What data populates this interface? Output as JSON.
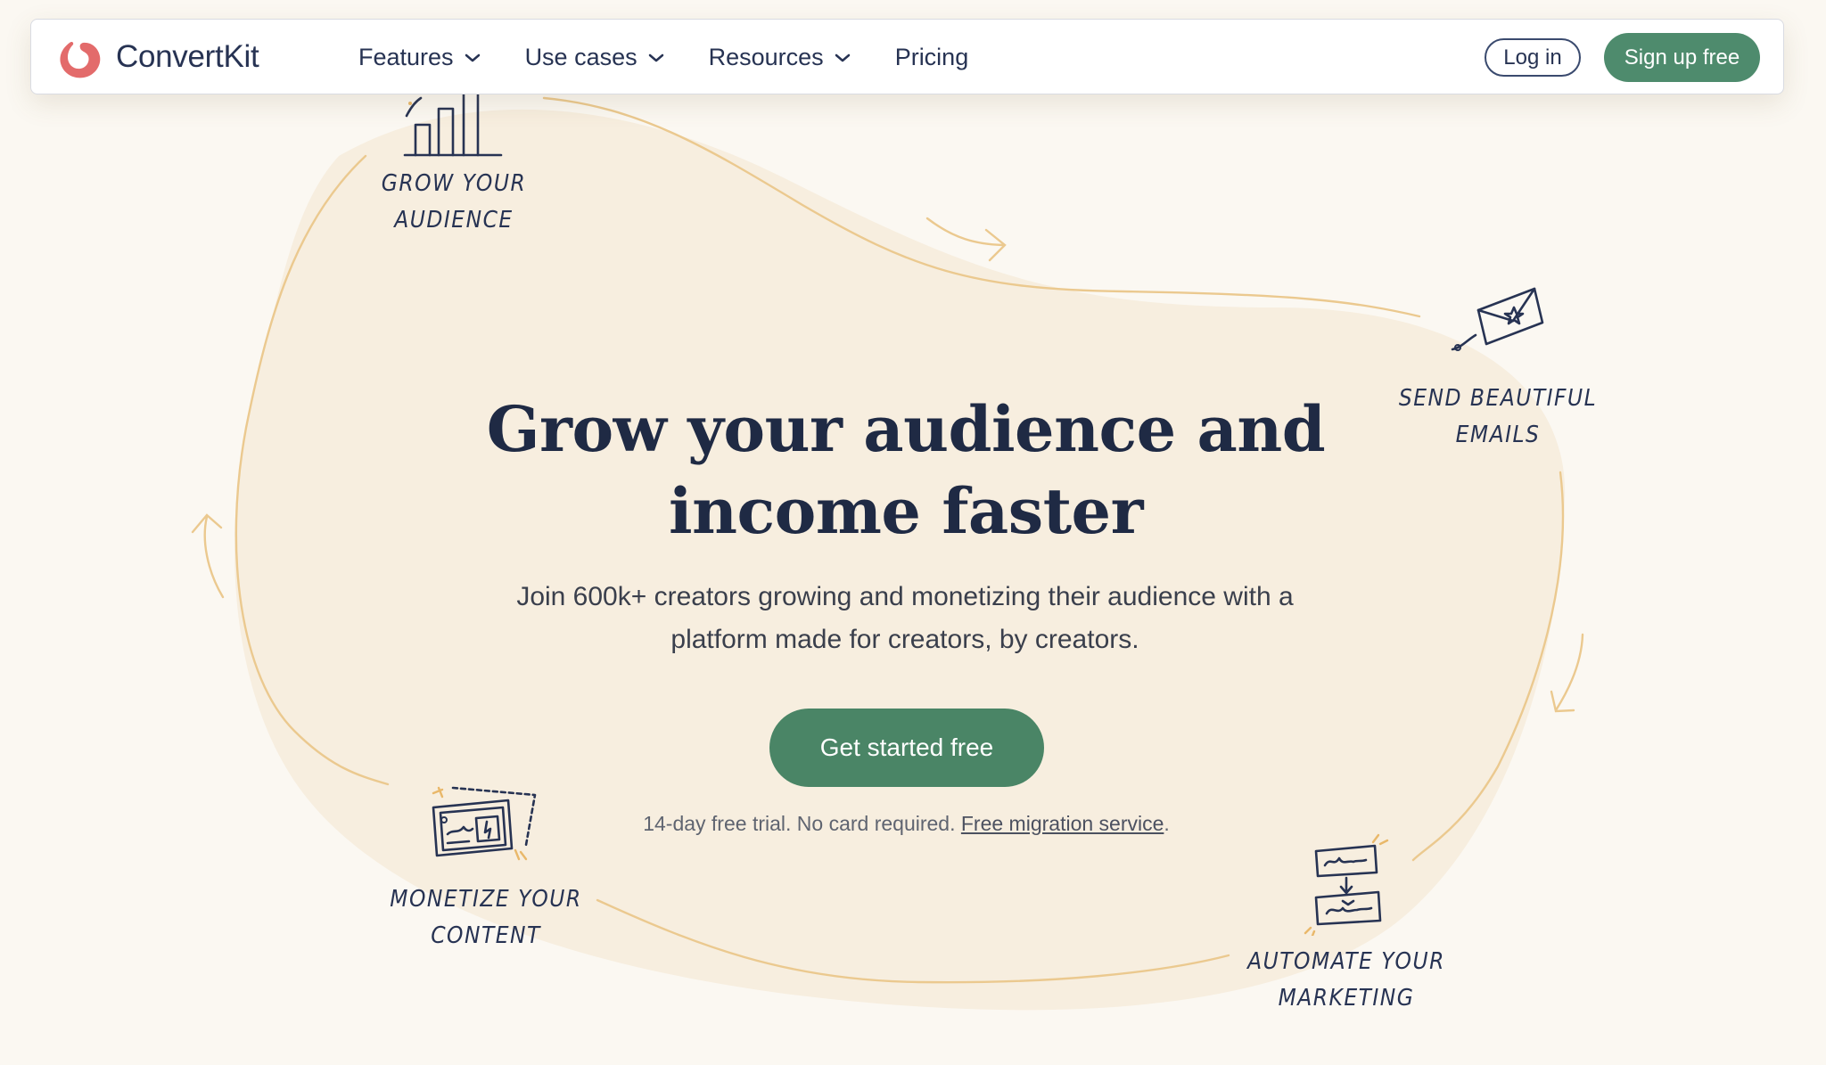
{
  "brand": {
    "name": "ConvertKit",
    "logo_icon": "convertkit-logo-icon",
    "accent": "#e36b6b"
  },
  "nav": {
    "items": [
      {
        "label": "Features",
        "has_dropdown": true
      },
      {
        "label": "Use cases",
        "has_dropdown": true
      },
      {
        "label": "Resources",
        "has_dropdown": true
      },
      {
        "label": "Pricing",
        "has_dropdown": false
      }
    ],
    "login_label": "Log in",
    "signup_label": "Sign up free"
  },
  "hero": {
    "title": "Grow your audience and income faster",
    "subtitle": "Join 600k+ creators growing and monetizing their audience with a platform made for creators, by creators.",
    "cta_label": "Get started free",
    "trial_note": "14-day free trial. No card required.",
    "migration_link": "Free migration service",
    "trial_suffix": "."
  },
  "features": {
    "grow": {
      "line1": "GROW YOUR",
      "line2": "AUDIENCE",
      "icon": "bar-chart-icon"
    },
    "send": {
      "line1": "SEND BEAUTIFUL",
      "line2": "EMAILS",
      "icon": "envelope-icon"
    },
    "monetize": {
      "line1": "MONETIZE YOUR",
      "line2": "CONTENT",
      "icon": "product-card-icon"
    },
    "automate": {
      "line1": "AUTOMATE YOUR",
      "line2": "MARKETING",
      "icon": "automation-flow-icon"
    }
  },
  "colors": {
    "background": "#fbf8f2",
    "blob": "#f6ecdd",
    "sketch_line": "#ebc98f",
    "primary_green": "#4a8566",
    "navy_text": "#1f2a44"
  }
}
